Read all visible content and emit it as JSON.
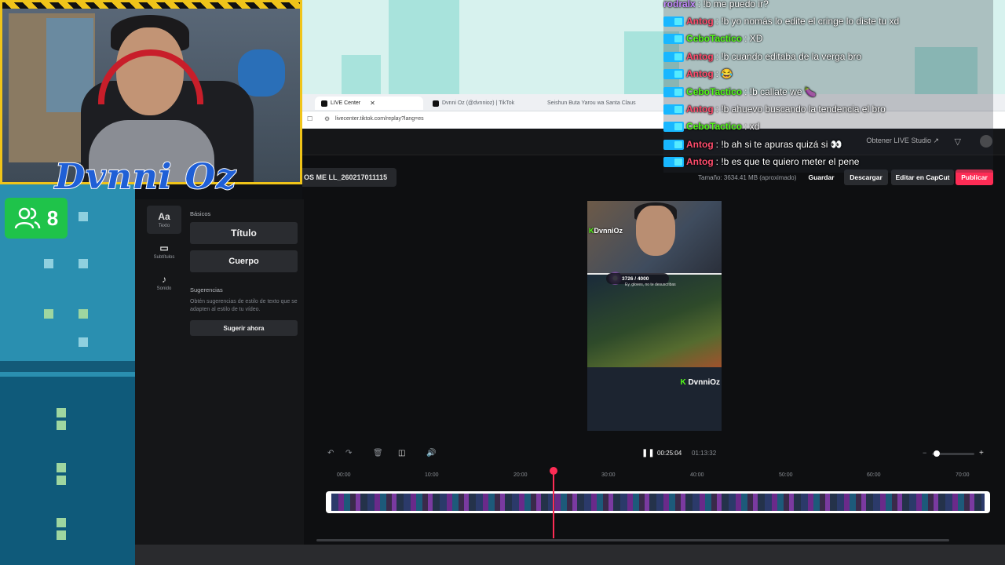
{
  "browser": {
    "tabs": [
      {
        "label": "LIVE Center",
        "active": true
      },
      {
        "label": "Dvnni Oz (@dvnnioz) | TikTok",
        "active": false
      },
      {
        "label": "Seishun Buta Yarou wa Santa Claus",
        "active": false
      }
    ],
    "url": "livecenter.tiktok.com/replay?lang=es"
  },
  "app": {
    "get_studio": "Obtener LIVE Studio ↗",
    "filename": "OS ME LL_260217011115",
    "size_label": "Tamaño: 3634.41 MB (aproximado)",
    "save": "Guardar",
    "download": "Descargar",
    "edit_capcut": "Editar en CapCut",
    "publish": "Publicar",
    "publish_color": "#fe2c55"
  },
  "sidebar": {
    "tools": [
      {
        "icon": "Aa",
        "label": "Texto"
      },
      {
        "icon": "▭",
        "label": "Subtítulos"
      },
      {
        "icon": "♪",
        "label": "Sonido"
      }
    ],
    "basics_heading": "Básicos",
    "title_btn": "Título",
    "body_btn": "Cuerpo",
    "suggestions_heading": "Sugerencias",
    "suggestions_desc": "Obtén sugerencias de estilo de texto que se adapten al estilo de tu vídeo.",
    "suggest_btn": "Sugerir ahora"
  },
  "preview": {
    "cam_name": "DvnniOz",
    "goal": "3726 / 4000",
    "goal_sub": "Ey, gloves, no te desuscribas",
    "bottom_name": "DvnniOz"
  },
  "timeline": {
    "current_time": "00:25:04",
    "total_time": "01:13:32",
    "ticks": [
      "00:00",
      "10:00",
      "20:00",
      "30:00",
      "40:00",
      "50:00",
      "60:00",
      "70:00"
    ],
    "progress": 0.341
  },
  "overlay": {
    "channel_name": "Dvnni Oz",
    "viewer_count": "8"
  },
  "chat": [
    {
      "user": "rodralx",
      "msg": ": !b me puedo ir?",
      "color": "#c58bff"
    },
    {
      "user": "Antog",
      "msg": ": !b yo nomás lo edite el cringe lo diste tu xd",
      "color": "#ff4d6d"
    },
    {
      "user": "CeboTactico",
      "msg": ": XD",
      "color": "#53fc18"
    },
    {
      "user": "Antog",
      "msg": ": !b cuando editaba de la verga bro",
      "color": "#ff4d6d"
    },
    {
      "user": "Antog",
      "msg": ": 😂",
      "color": "#ff4d6d"
    },
    {
      "user": "CeboTactico",
      "msg": ": !b callate we 🍆",
      "color": "#53fc18"
    },
    {
      "user": "Antog",
      "msg": ": !b ahuevo buscando la tendencia el bro",
      "color": "#ff4d6d"
    },
    {
      "user": "CeboTactico",
      "msg": ": xd",
      "color": "#53fc18"
    },
    {
      "user": "Antog",
      "msg": ": !b ah si te apuras quizá si 👀",
      "color": "#ff4d6d"
    },
    {
      "user": "Antog",
      "msg": ": !b es que te quiero meter el pene",
      "color": "#ff4d6d"
    }
  ]
}
